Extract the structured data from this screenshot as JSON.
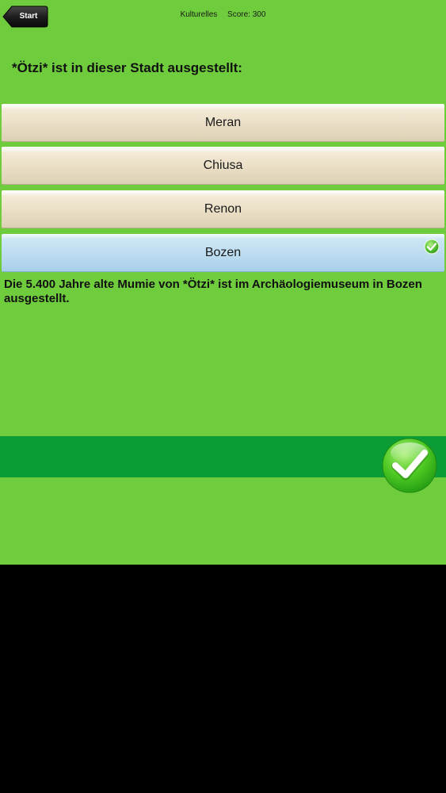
{
  "header": {
    "back_label": "Start",
    "category": "Kulturelles",
    "score": "Score: 300"
  },
  "question": {
    "text": "*Ötzi* ist in dieser Stadt ausgestellt:"
  },
  "answers": [
    {
      "label": "Meran",
      "state": "default"
    },
    {
      "label": "Chiusa",
      "state": "default"
    },
    {
      "label": "Renon",
      "state": "default"
    },
    {
      "label": "Bozen",
      "state": "correct"
    }
  ],
  "explanation": {
    "text": "Die 5.400 Jahre alte Mumie von *Ötzi* ist im Archäologiemuseum in Bozen ausgestellt."
  },
  "icons": {
    "back": "back-arrow-icon",
    "answer_correct": "checkmark-icon",
    "confirm": "checkmark-icon"
  },
  "colors": {
    "background": "#6fcc3d",
    "confirm_bar": "#0b9c35",
    "answer_default": "#ebe0c7",
    "answer_correct": "#bcdcf0",
    "letterbox": "#000000"
  }
}
